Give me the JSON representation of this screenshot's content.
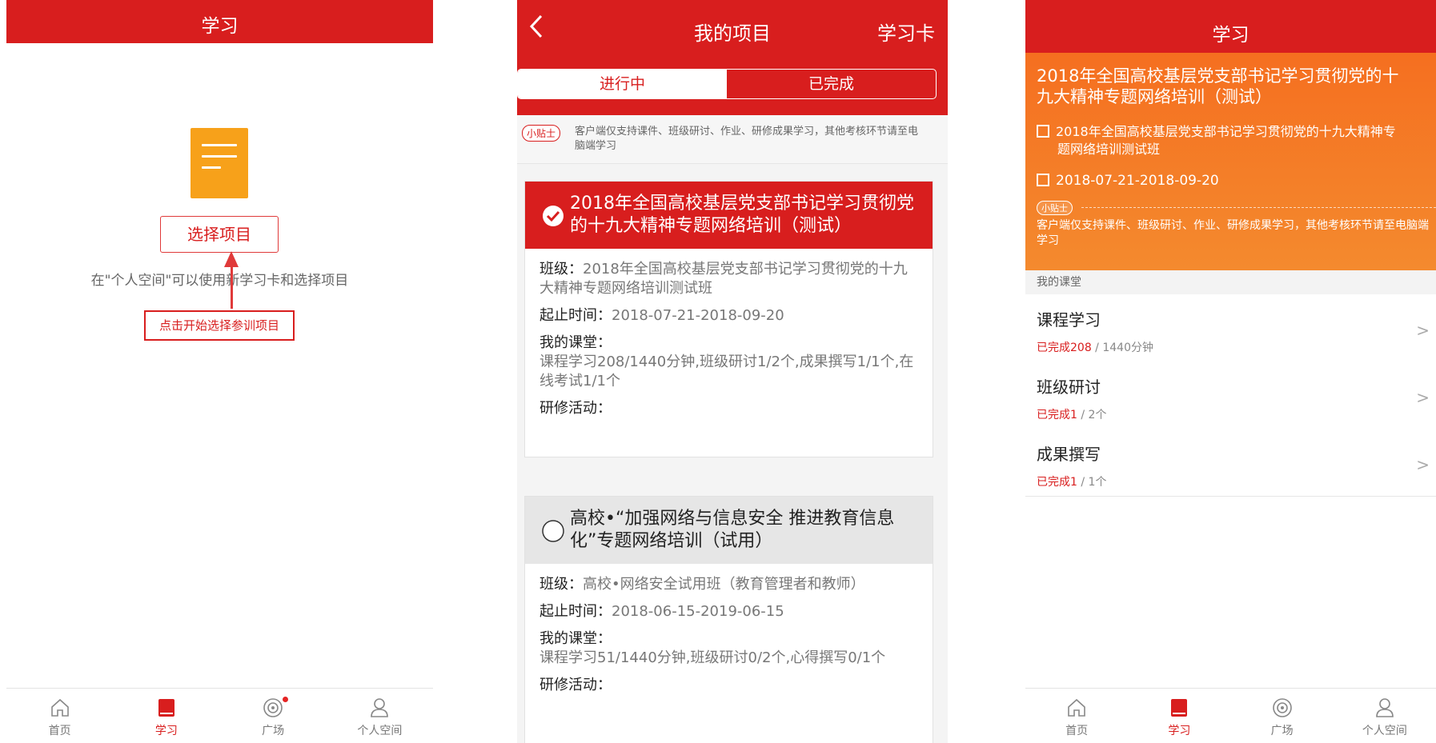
{
  "screen1": {
    "title": "学习",
    "select_button": "选择项目",
    "hint": "在\"个人空间\"可以使用新学习卡和选择项目",
    "callout": "点击开始选择参训项目"
  },
  "screen2": {
    "title": "我的项目",
    "card_link": "学习卡",
    "tabs": [
      "进行中",
      "已完成"
    ],
    "tip_badge": "小贴士",
    "tip_text": "客户端仅支持课件、班级研讨、作业、研修成果学习，其他考核环节请至电脑端学习",
    "projects": [
      {
        "title": "2018年全国高校基层党支部书记学习贯彻党的十九大精神专题网络培训（测试）",
        "class_label": "班级：",
        "class_value": "2018年全国高校基层党支部书记学习贯彻党的十九大精神专题网络培训测试班",
        "time_label": "起止时间：",
        "time_value": "2018-07-21-2018-09-20",
        "classroom_label": "我的课堂：",
        "classroom_value": "课程学习208/1440分钟,班级研讨1/2个,成果撰写1/1个,在线考试1/1个",
        "activity_label": "研修活动："
      },
      {
        "title": "高校•“加强网络与信息安全 推进教育信息化”专题网络培训（试用）",
        "class_label": "班级：",
        "class_value": "高校•网络安全试用班（教育管理者和教师）",
        "time_label": "起止时间：",
        "time_value": "2018-06-15-2019-06-15",
        "classroom_label": "我的课堂：",
        "classroom_value": "课程学习51/1440分钟,班级研讨0/2个,心得撰写0/1个",
        "activity_label": "研修活动："
      }
    ]
  },
  "screen3": {
    "title": "学习",
    "project_title": "2018年全国高校基层党支部书记学习贯彻党的十九大精神专题网络培训（测试）",
    "class_line1": "2018年全国高校基层党支部书记学习贯彻党的十九大精神专",
    "class_line2": "题网络培训测试班",
    "date": "2018-07-21-2018-09-20",
    "tip_badge": "小贴士",
    "tip": "客户端仅支持课件、班级研讨、作业、研修成果学习，其他考核环节请至电脑端学习",
    "section_label": "我的课堂",
    "items": [
      {
        "name": "课程学习",
        "done_label": "已完成208",
        "total": " / 1440分钟"
      },
      {
        "name": "班级研讨",
        "done_label": "已完成1",
        "total": " / 2个"
      },
      {
        "name": "成果撰写",
        "done_label": "已完成1",
        "total": " / 1个"
      }
    ]
  },
  "tabbar": [
    "首页",
    "学习",
    "广场",
    "个人空间"
  ],
  "colors": {
    "brand_red": "#d81e1e",
    "hero_orange": "#f56f20",
    "doc_icon_orange": "#f7a11a"
  }
}
